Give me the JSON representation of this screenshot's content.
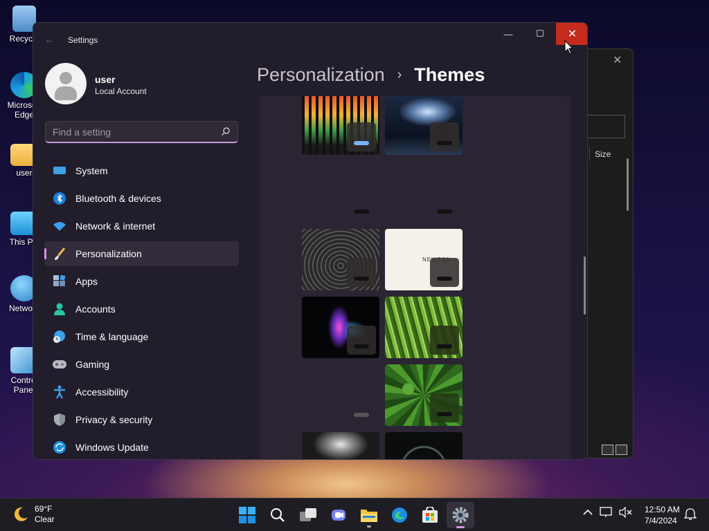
{
  "desktop": {
    "icons": [
      {
        "label": "Recycle",
        "icon": "recycle-bin-icon"
      },
      {
        "label": "Microsoft Edge",
        "icon": "edge-icon"
      },
      {
        "label": "user",
        "icon": "folder-icon"
      },
      {
        "label": "This PC",
        "icon": "this-pc-icon"
      },
      {
        "label": "Network",
        "icon": "network-icon"
      },
      {
        "label": "Control Panel",
        "icon": "control-panel-icon"
      }
    ]
  },
  "background_window": {
    "column_header": "Size",
    "close_glyph": "✕"
  },
  "settings": {
    "app_title": "Settings",
    "controls": {
      "minimize": "—",
      "maximize": "☐",
      "close": "✕"
    },
    "user": {
      "name": "user",
      "account_type": "Local Account"
    },
    "search": {
      "placeholder": "Find a setting"
    },
    "nav": [
      {
        "label": "System",
        "icon": "system-icon",
        "active": false
      },
      {
        "label": "Bluetooth & devices",
        "icon": "bluetooth-icon",
        "active": false
      },
      {
        "label": "Network & internet",
        "icon": "wifi-icon",
        "active": false
      },
      {
        "label": "Personalization",
        "icon": "brush-icon",
        "active": true
      },
      {
        "label": "Apps",
        "icon": "apps-icon",
        "active": false
      },
      {
        "label": "Accounts",
        "icon": "accounts-icon",
        "active": false
      },
      {
        "label": "Time & language",
        "icon": "time-language-icon",
        "active": false
      },
      {
        "label": "Gaming",
        "icon": "gaming-icon",
        "active": false
      },
      {
        "label": "Accessibility",
        "icon": "accessibility-icon",
        "active": false
      },
      {
        "label": "Privacy & security",
        "icon": "shield-icon",
        "active": false
      },
      {
        "label": "Windows Update",
        "icon": "windows-update-icon",
        "active": false
      }
    ],
    "breadcrumb": {
      "parent": "Personalization",
      "separator": "›",
      "current": "Themes"
    },
    "theme_tiles": [
      {
        "name": "theme-equalizer-dancer"
      },
      {
        "name": "theme-lightning-city"
      },
      {
        "name": "theme-blank-1"
      },
      {
        "name": "theme-blank-2"
      },
      {
        "name": "theme-sports-car"
      },
      {
        "name": "theme-newton-white"
      },
      {
        "name": "theme-neon-city-night"
      },
      {
        "name": "theme-green-grass"
      },
      {
        "name": "theme-blank-3"
      },
      {
        "name": "theme-cannabis-leaves"
      },
      {
        "name": "theme-dark-spotlight"
      },
      {
        "name": "theme-dark-emblem"
      }
    ],
    "newton_text": "NEWTON"
  },
  "taskbar": {
    "weather": {
      "temp": "69°F",
      "condition": "Clear"
    },
    "apps": [
      "start-icon",
      "search-icon",
      "task-view-icon",
      "chat-icon",
      "file-explorer-icon",
      "edge-icon",
      "store-icon",
      "settings-icon"
    ],
    "clock": {
      "time": "12:50 AM",
      "date": "7/4/2024"
    }
  },
  "colors": {
    "accent": "#d493e8",
    "close_red": "#c42b1c"
  }
}
